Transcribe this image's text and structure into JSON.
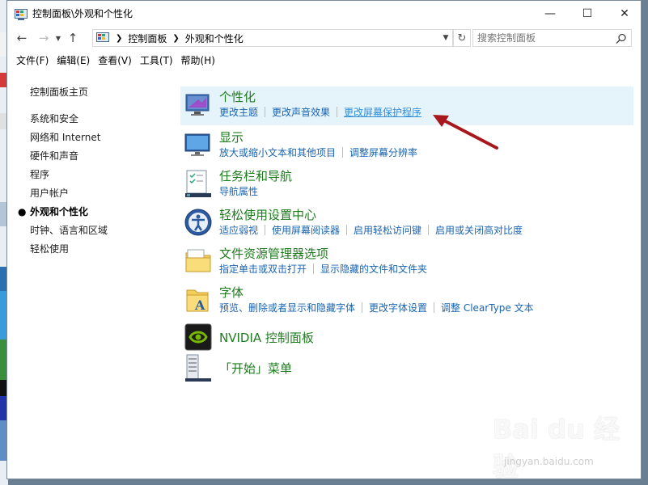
{
  "window": {
    "title": "控制面板\\外观和个性化"
  },
  "breadcrumb": [
    "控制面板",
    "外观和个性化"
  ],
  "search": {
    "placeholder": "搜索控制面板"
  },
  "menu": [
    "文件(F)",
    "编辑(E)",
    "查看(V)",
    "工具(T)",
    "帮助(H)"
  ],
  "sidebar": {
    "home": "控制面板主页",
    "items": [
      "系统和安全",
      "网络和 Internet",
      "硬件和声音",
      "程序",
      "用户帐户",
      "外观和个性化",
      "时钟、语言和区域",
      "轻松使用"
    ],
    "active_index": 5
  },
  "categories": [
    {
      "title": "个性化",
      "icon": "personalization-icon",
      "links": [
        "更改主题",
        "更改声音效果",
        "更改屏幕保护程序"
      ]
    },
    {
      "title": "显示",
      "icon": "display-icon",
      "links": [
        "放大或缩小文本和其他项目",
        "调整屏幕分辨率"
      ]
    },
    {
      "title": "任务栏和导航",
      "icon": "taskbar-icon",
      "links": [
        "导航属性"
      ]
    },
    {
      "title": "轻松使用设置中心",
      "icon": "ease-of-access-icon",
      "links": [
        "适应弱视",
        "使用屏幕阅读器",
        "启用轻松访问键",
        "启用或关闭高对比度"
      ]
    },
    {
      "title": "文件资源管理器选项",
      "icon": "folder-options-icon",
      "links": [
        "指定单击或双击打开",
        "显示隐藏的文件和文件夹"
      ]
    },
    {
      "title": "字体",
      "icon": "fonts-icon",
      "links": [
        "预览、删除或者显示和隐藏字体",
        "更改字体设置",
        "调整 ClearType 文本"
      ]
    },
    {
      "title": "NVIDIA 控制面板",
      "icon": "nvidia-icon",
      "links": []
    },
    {
      "title": "「开始」菜单",
      "icon": "start-menu-icon",
      "links": []
    }
  ],
  "watermark": {
    "brand": "Bai du 经验",
    "url": "jingyan.baidu.com"
  },
  "colors": {
    "category_title": "#1e7b1e",
    "link": "#1a64b0",
    "highlight": "#e5f3fb",
    "annotation_arrow": "#a8171b"
  }
}
